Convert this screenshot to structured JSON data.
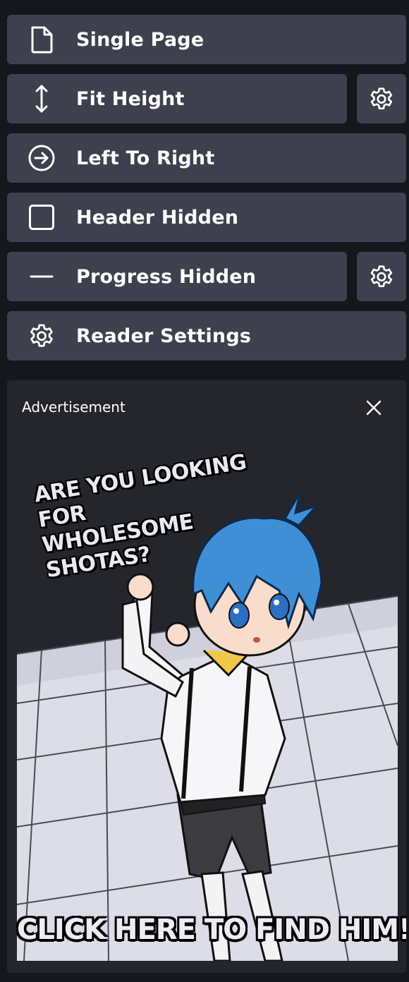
{
  "menu": {
    "single_page": {
      "label": "Single Page",
      "icon": "page-icon"
    },
    "fit_height": {
      "label": "Fit Height",
      "icon": "vertical-arrows-icon"
    },
    "direction": {
      "label": "Left To Right",
      "icon": "arrow-right-circle-icon"
    },
    "header": {
      "label": "Header Hidden",
      "icon": "checkbox-empty-icon"
    },
    "progress": {
      "label": "Progress Hidden",
      "icon": "dash-icon"
    },
    "reader_settings": {
      "label": "Reader Settings",
      "icon": "gear-icon"
    }
  },
  "advertisement": {
    "label": "Advertisement",
    "headline": "ARE YOU LOOKING FOR WHOLESOME SHOTAS?",
    "headline_line1": "ARE YOU LOOKING FOR",
    "headline_line2": "WHOLESOME SHOTAS?",
    "cta": "CLICK HERE TO FIND HIM!"
  },
  "colors": {
    "background": "#15171c",
    "button": "#3e414d",
    "ad_panel": "#25262b",
    "text": "#ffffff"
  }
}
